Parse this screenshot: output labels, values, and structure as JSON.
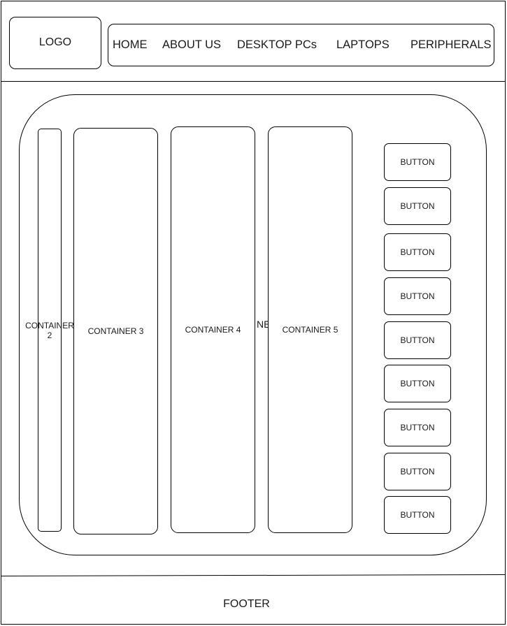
{
  "header": {
    "logo_label": "LOGO",
    "nav": [
      "HOME",
      "ABOUT US",
      "DESKTOP PCs",
      "LAPTOPS",
      "PERIPHERALS"
    ]
  },
  "main": {
    "panel_label": "NE",
    "containers": [
      "CONTAINER 2",
      "CONTAINER 3",
      "CONTAINER 4",
      "CONTAINER 5"
    ],
    "buttons": [
      "BUTTON",
      "BUTTON",
      "BUTTON",
      "BUTTON",
      "BUTTON",
      "BUTTON",
      "BUTTON",
      "BUTTON",
      "BUTTON"
    ]
  },
  "footer": {
    "label": "FOOTER"
  }
}
